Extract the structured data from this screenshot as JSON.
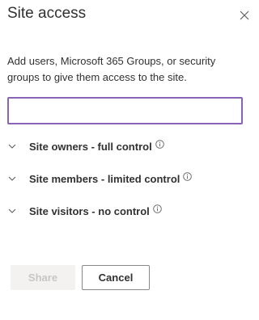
{
  "panel": {
    "title": "Site access",
    "close_icon": "close-icon",
    "description": "Add users, Microsoft 365 Groups, or security groups to give them access to the site.",
    "search": {
      "value": "",
      "placeholder": ""
    },
    "groups": [
      {
        "label": "Site owners - full control",
        "expanded": false
      },
      {
        "label": "Site members - limited control",
        "expanded": false
      },
      {
        "label": "Site visitors - no control",
        "expanded": false
      }
    ],
    "buttons": {
      "share_label": "Share",
      "share_disabled": true,
      "cancel_label": "Cancel"
    }
  },
  "colors": {
    "accent": "#8764b8",
    "text": "#323130",
    "disabled_bg": "#f3f2f1",
    "disabled_text": "#c8c6c4",
    "border": "#8a8886"
  }
}
